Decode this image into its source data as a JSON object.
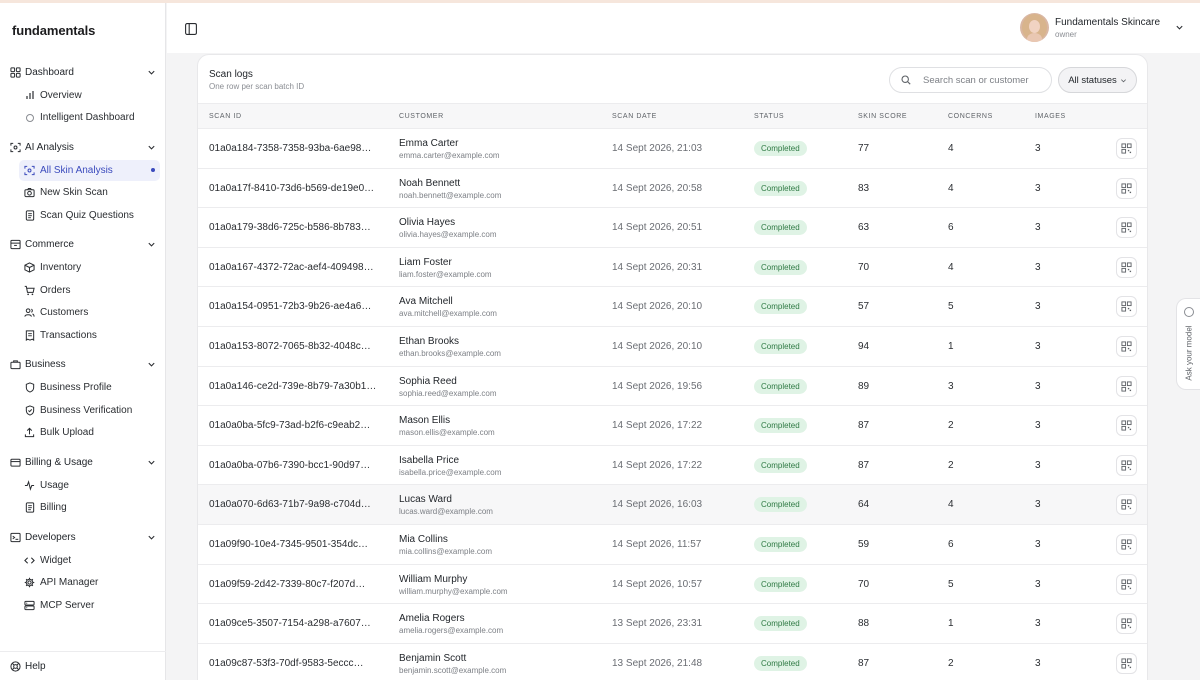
{
  "app": {
    "brand": "fundamentals"
  },
  "nav": {
    "groups": [
      {
        "label": "Dashboard",
        "icon": "grid-icon",
        "items": [
          {
            "label": "Overview",
            "icon": "bar-chart-icon"
          },
          {
            "label": "Intelligent Dashboard",
            "icon": "circle-icon"
          }
        ]
      },
      {
        "label": "AI Analysis",
        "icon": "scan-icon",
        "items": [
          {
            "label": "All Skin Analysis",
            "icon": "scan-icon",
            "active": true
          },
          {
            "label": "New Skin Scan",
            "icon": "camera-icon"
          },
          {
            "label": "Scan Quiz Questions",
            "icon": "document-icon"
          }
        ]
      },
      {
        "label": "Commerce",
        "icon": "box-icon",
        "items": [
          {
            "label": "Inventory",
            "icon": "package-icon"
          },
          {
            "label": "Orders",
            "icon": "cart-icon"
          },
          {
            "label": "Customers",
            "icon": "users-icon"
          },
          {
            "label": "Transactions",
            "icon": "receipt-icon"
          }
        ]
      },
      {
        "label": "Business",
        "icon": "briefcase-icon",
        "items": [
          {
            "label": "Business Profile",
            "icon": "shield-icon"
          },
          {
            "label": "Business Verification",
            "icon": "shield-check-icon"
          },
          {
            "label": "Bulk Upload",
            "icon": "upload-icon"
          }
        ]
      },
      {
        "label": "Billing & Usage",
        "icon": "credit-card-icon",
        "items": [
          {
            "label": "Usage",
            "icon": "activity-icon"
          },
          {
            "label": "Billing",
            "icon": "document-icon"
          }
        ]
      },
      {
        "label": "Developers",
        "icon": "terminal-icon",
        "items": [
          {
            "label": "Widget",
            "icon": "code-icon"
          },
          {
            "label": "API Manager",
            "icon": "gear-icon"
          },
          {
            "label": "MCP Server",
            "icon": "server-icon"
          }
        ]
      }
    ],
    "help": "Help"
  },
  "user": {
    "name": "Fundamentals Skincare",
    "role": "owner"
  },
  "panel": {
    "title": "Scan logs",
    "subtitle": "One row per scan batch ID",
    "search_placeholder": "Search scan or customer",
    "status_filter": "All statuses"
  },
  "table": {
    "columns": [
      "Scan ID",
      "Customer",
      "Scan Date",
      "Status",
      "Skin Score",
      "Concerns",
      "Images"
    ],
    "rows": [
      {
        "id": "01a0a184-7358-7358-93ba-6ae98…",
        "name": "Emma Carter",
        "email": "emma.carter@example.com",
        "date": "14 Sept 2026, 21:03",
        "status": "Completed",
        "score": "77",
        "concerns": "4",
        "images": "3"
      },
      {
        "id": "01a0a17f-8410-73d6-b569-de19e0…",
        "name": "Noah Bennett",
        "email": "noah.bennett@example.com",
        "date": "14 Sept 2026, 20:58",
        "status": "Completed",
        "score": "83",
        "concerns": "4",
        "images": "3"
      },
      {
        "id": "01a0a179-38d6-725c-b586-8b783…",
        "name": "Olivia Hayes",
        "email": "olivia.hayes@example.com",
        "date": "14 Sept 2026, 20:51",
        "status": "Completed",
        "score": "63",
        "concerns": "6",
        "images": "3"
      },
      {
        "id": "01a0a167-4372-72ac-aef4-409498…",
        "name": "Liam Foster",
        "email": "liam.foster@example.com",
        "date": "14 Sept 2026, 20:31",
        "status": "Completed",
        "score": "70",
        "concerns": "4",
        "images": "3"
      },
      {
        "id": "01a0a154-0951-72b3-9b26-ae4a6…",
        "name": "Ava Mitchell",
        "email": "ava.mitchell@example.com",
        "date": "14 Sept 2026, 20:10",
        "status": "Completed",
        "score": "57",
        "concerns": "5",
        "images": "3"
      },
      {
        "id": "01a0a153-8072-7065-8b32-4048c…",
        "name": "Ethan Brooks",
        "email": "ethan.brooks@example.com",
        "date": "14 Sept 2026, 20:10",
        "status": "Completed",
        "score": "94",
        "concerns": "1",
        "images": "3"
      },
      {
        "id": "01a0a146-ce2d-739e-8b79-7a30b1…",
        "name": "Sophia Reed",
        "email": "sophia.reed@example.com",
        "date": "14 Sept 2026, 19:56",
        "status": "Completed",
        "score": "89",
        "concerns": "3",
        "images": "3"
      },
      {
        "id": "01a0a0ba-5fc9-73ad-b2f6-c9eab2…",
        "name": "Mason Ellis",
        "email": "mason.ellis@example.com",
        "date": "14 Sept 2026, 17:22",
        "status": "Completed",
        "score": "87",
        "concerns": "2",
        "images": "3"
      },
      {
        "id": "01a0a0ba-07b6-7390-bcc1-90d97…",
        "name": "Isabella Price",
        "email": "isabella.price@example.com",
        "date": "14 Sept 2026, 17:22",
        "status": "Completed",
        "score": "87",
        "concerns": "2",
        "images": "3"
      },
      {
        "id": "01a0a070-6d63-71b7-9a98-c704d…",
        "name": "Lucas Ward",
        "email": "lucas.ward@example.com",
        "date": "14 Sept 2026, 16:03",
        "status": "Completed",
        "score": "64",
        "concerns": "4",
        "images": "3",
        "highlight": true
      },
      {
        "id": "01a09f90-10e4-7345-9501-354dc…",
        "name": "Mia Collins",
        "email": "mia.collins@example.com",
        "date": "14 Sept 2026, 11:57",
        "status": "Completed",
        "score": "59",
        "concerns": "6",
        "images": "3"
      },
      {
        "id": "01a09f59-2d42-7339-80c7-f207d…",
        "name": "William Murphy",
        "email": "william.murphy@example.com",
        "date": "14 Sept 2026, 10:57",
        "status": "Completed",
        "score": "70",
        "concerns": "5",
        "images": "3"
      },
      {
        "id": "01a09ce5-3507-7154-a298-a7607…",
        "name": "Amelia Rogers",
        "email": "amelia.rogers@example.com",
        "date": "13 Sept 2026, 23:31",
        "status": "Completed",
        "score": "88",
        "concerns": "1",
        "images": "3"
      },
      {
        "id": "01a09c87-53f3-70df-9583-5eccc…",
        "name": "Benjamin Scott",
        "email": "benjamin.scott@example.com",
        "date": "13 Sept 2026, 21:48",
        "status": "Completed",
        "score": "87",
        "concerns": "2",
        "images": "3"
      }
    ]
  },
  "side_tab": {
    "label": "Ask your model"
  },
  "colors": {
    "accent": "#3b4bbd",
    "status_bg": "#dff3e5",
    "status_text": "#2f7a44"
  }
}
